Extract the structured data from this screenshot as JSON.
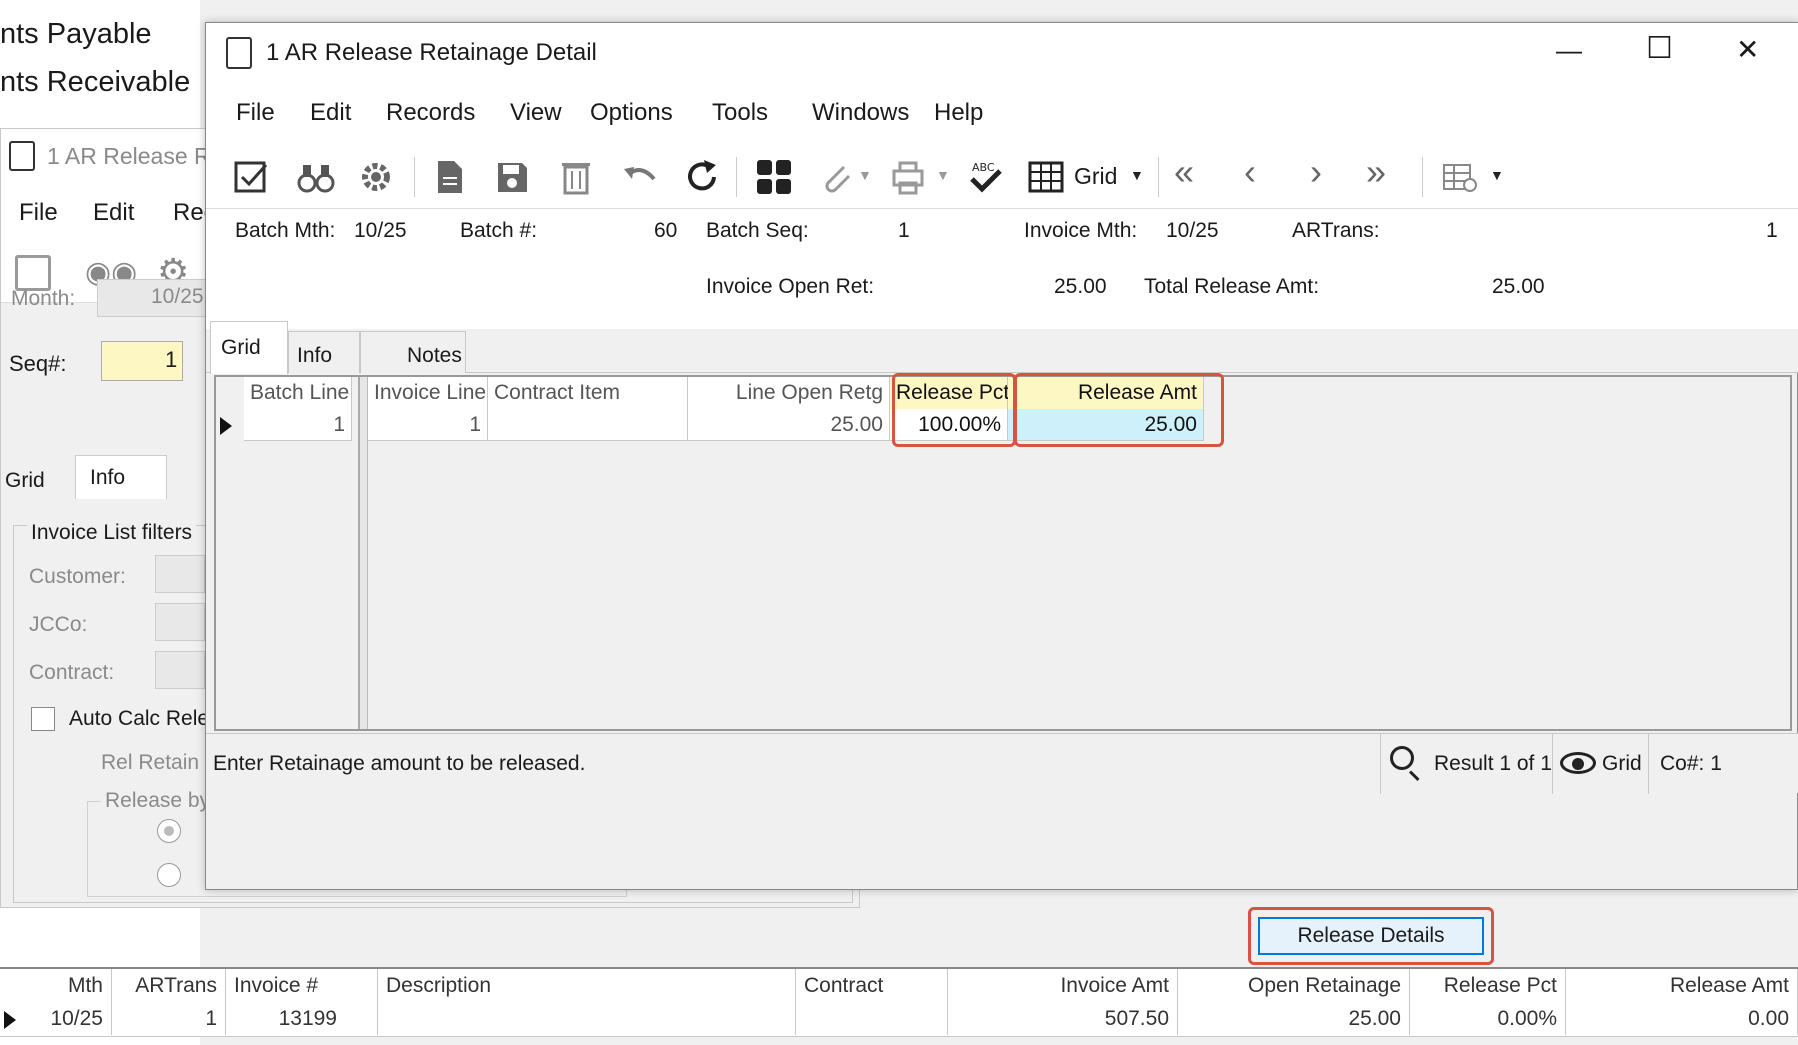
{
  "background": {
    "module_items": [
      "nts Payable",
      "nts Receivable"
    ],
    "back_window": {
      "title": "1 AR Release R",
      "menu": [
        "File",
        "Edit",
        "Rec"
      ],
      "month_label": "Month:",
      "month_value": "10/25",
      "seq_label": "Seq#:",
      "seq_value": "1",
      "tabs": [
        "Grid",
        "Info"
      ],
      "filters_legend": "Invoice List filters",
      "filter_labels": [
        "Customer:",
        "JCCo:",
        "Contract:"
      ],
      "auto_calc_label": "Auto Calc Rele",
      "rel_retain_label": "Rel Retain",
      "release_by_label": "Release by",
      "release_details_button": "Release Details"
    },
    "bottom_grid": {
      "columns": [
        "Mth",
        "ARTrans",
        "Invoice #",
        "Description",
        "Contract",
        "Invoice Amt",
        "Open Retainage",
        "Release Pct",
        "Release Amt"
      ],
      "row": [
        "10/25",
        "1",
        "13199",
        "",
        "",
        "507.50",
        "25.00",
        "0.00%",
        "0.00"
      ]
    }
  },
  "window": {
    "title": "1 AR Release Retainage Detail",
    "controls": {
      "minimize": "—",
      "maximize": "☐",
      "close": "✕"
    },
    "menu": [
      "File",
      "Edit",
      "Records",
      "View",
      "Options",
      "Tools",
      "Windows",
      "Help"
    ],
    "toolbar": {
      "grid_label": "Grid",
      "icons": [
        "edit-icon",
        "binoculars-icon",
        "settings-icon",
        "new-document-icon",
        "save-icon",
        "delete-icon",
        "undo-icon",
        "refresh-icon",
        "calculator-icon",
        "attachment-icon",
        "print-icon",
        "spellcheck-icon",
        "grid-icon",
        "first-record-icon",
        "previous-record-icon",
        "next-record-icon",
        "last-record-icon",
        "layout-settings-icon"
      ]
    },
    "header": {
      "batch_mth_label": "Batch Mth:",
      "batch_mth_value": "10/25",
      "batch_no_label": "Batch #:",
      "batch_no_value": "60",
      "batch_seq_label": "Batch Seq:",
      "batch_seq_value": "1",
      "invoice_mth_label": "Invoice Mth:",
      "invoice_mth_value": "10/25",
      "artrans_label": "ARTrans:",
      "artrans_value": "1",
      "invoice_open_ret_label": "Invoice Open Ret:",
      "invoice_open_ret_value": "25.00",
      "total_release_label": "Total Release Amt:",
      "total_release_value": "25.00"
    },
    "tabs": [
      "Grid",
      "Info",
      "Notes"
    ],
    "grid": {
      "columns": [
        "Batch Line",
        "Invoice Line",
        "Contract Item",
        "Line Open Retg",
        "Release Pct",
        "Release Amt"
      ],
      "row": [
        "1",
        "1",
        "",
        "25.00",
        "100.00%",
        "25.00"
      ]
    },
    "status": {
      "message": "Enter Retainage amount to be released.",
      "result": "Result 1 of 1",
      "view": "Grid",
      "company": "Co#: 1"
    },
    "colors": {
      "highlight_border": "#d9543e",
      "header_yellow": "#fdf7c3",
      "selected_cell": "#cdf0fb"
    }
  }
}
